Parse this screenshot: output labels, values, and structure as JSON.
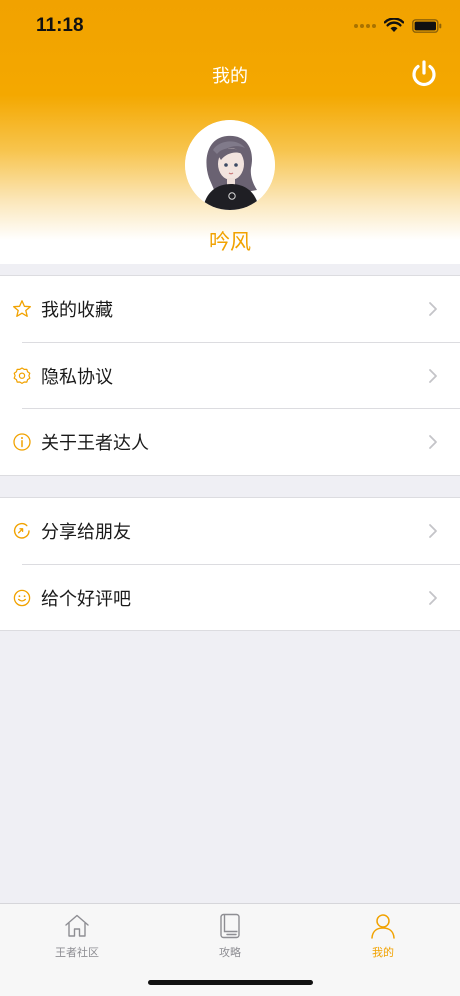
{
  "status_bar": {
    "time": "11:18"
  },
  "nav": {
    "title": "我的",
    "power_icon": "power-icon"
  },
  "profile": {
    "username": "吟风",
    "avatar_icon": "avatar-portrait"
  },
  "menu_group_1": [
    {
      "label": "我的收藏",
      "icon": "star-icon"
    },
    {
      "label": "隐私协议",
      "icon": "gear-icon"
    },
    {
      "label": "关于王者达人",
      "icon": "info-icon"
    }
  ],
  "menu_group_2": [
    {
      "label": "分享给朋友",
      "icon": "share-icon"
    },
    {
      "label": "给个好评吧",
      "icon": "smile-icon"
    }
  ],
  "tabs": [
    {
      "label": "王者社区",
      "icon": "home-icon",
      "active": false
    },
    {
      "label": "攻略",
      "icon": "book-icon",
      "active": false
    },
    {
      "label": "我的",
      "icon": "person-icon",
      "active": true
    }
  ],
  "colors": {
    "accent": "#f1a200",
    "background": "#efeff4"
  }
}
